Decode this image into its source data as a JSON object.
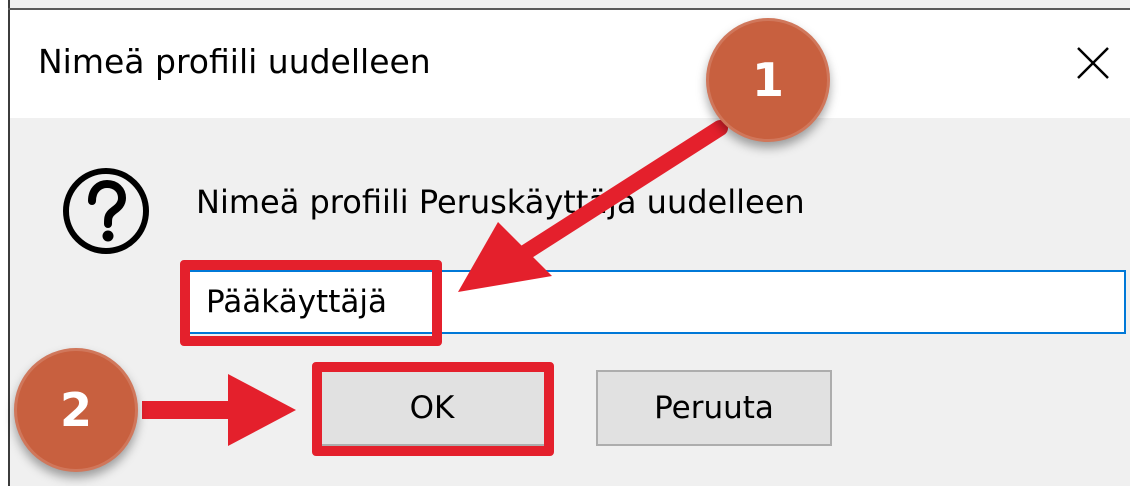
{
  "window": {
    "title": "Nimeä profiili uudelleen",
    "close_icon": "close-icon"
  },
  "dialog": {
    "icon": "question-mark-icon",
    "prompt": "Nimeä profiili Peruskäyttäjä uudelleen",
    "input_value": "Pääkäyttäjä",
    "ok_label": "OK",
    "cancel_label": "Peruuta"
  },
  "annotations": {
    "step1": "1",
    "step2": "2",
    "badge_color": "#c8603f",
    "highlight_color": "#e4202c"
  },
  "colors": {
    "input_border": "#0078d7",
    "button_bg": "#e1e1e1",
    "dialog_bg": "#f0f0f0"
  }
}
